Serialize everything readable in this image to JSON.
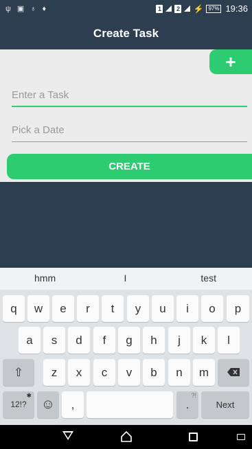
{
  "status_bar": {
    "left_icons": [
      "usb-icon",
      "image-icon",
      "tune-icon",
      "location-icon"
    ],
    "sim1": "1",
    "sim2": "2",
    "battery": "97%",
    "time": "19:36"
  },
  "app_bar": {
    "title": "Create Task"
  },
  "form": {
    "add_button_label": "+",
    "task_placeholder": "Enter a Task",
    "date_placeholder": "Pick a Date",
    "create_label": "CREATE"
  },
  "colors": {
    "primary_dark": "#2c3e50",
    "accent_green": "#2ecc71",
    "content_bg": "#ececec"
  },
  "keyboard": {
    "suggestions": [
      "hmm",
      "I",
      "test"
    ],
    "row1": [
      "q",
      "w",
      "e",
      "r",
      "t",
      "y",
      "u",
      "i",
      "o",
      "p"
    ],
    "row2": [
      "a",
      "s",
      "d",
      "f",
      "g",
      "h",
      "j",
      "k",
      "l"
    ],
    "row3": [
      "z",
      "x",
      "c",
      "v",
      "b",
      "n",
      "m"
    ],
    "symbols_key": "12!?",
    "comma_key": ",",
    "period_key": ".",
    "period_sub": "?!",
    "next_key": "Next",
    "shift_glyph": "⇧",
    "emoji_glyph": "☺"
  }
}
